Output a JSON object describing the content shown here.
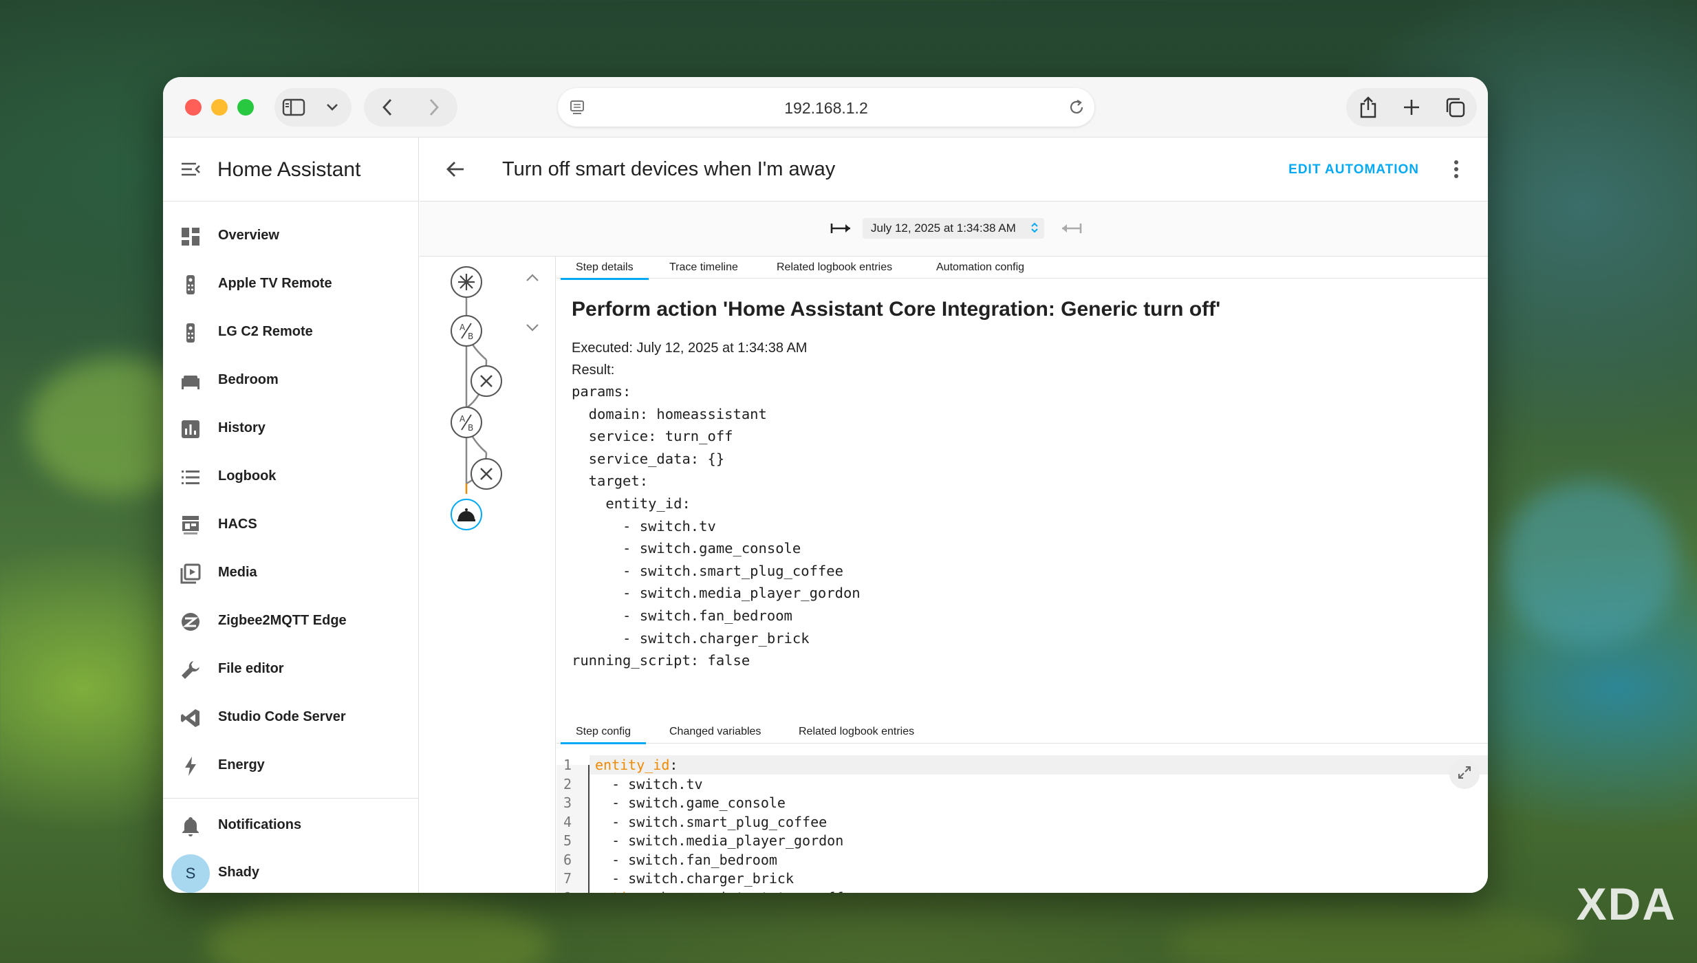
{
  "browser": {
    "url": "192.168.1.2"
  },
  "sidebar": {
    "app_title": "Home Assistant",
    "items": [
      {
        "label": "Overview",
        "icon": "overview-icon"
      },
      {
        "label": "Apple TV Remote",
        "icon": "remote-icon"
      },
      {
        "label": "LG C2 Remote",
        "icon": "remote-icon"
      },
      {
        "label": "Bedroom",
        "icon": "bed-icon"
      },
      {
        "label": "History",
        "icon": "chart-icon"
      },
      {
        "label": "Logbook",
        "icon": "list-icon"
      },
      {
        "label": "HACS",
        "icon": "hacs-icon"
      },
      {
        "label": "Media",
        "icon": "media-icon"
      },
      {
        "label": "Zigbee2MQTT Edge",
        "icon": "zigbee-icon"
      },
      {
        "label": "File editor",
        "icon": "wrench-icon"
      },
      {
        "label": "Studio Code Server",
        "icon": "vscode-icon"
      },
      {
        "label": "Energy",
        "icon": "lightning-icon"
      }
    ],
    "notifications_label": "Notifications",
    "user": {
      "initial": "S",
      "name": "Shady"
    }
  },
  "toolbar": {
    "title": "Turn off smart devices when I'm away",
    "edit_label": "EDIT AUTOMATION"
  },
  "trace": {
    "selected_run": "July 12, 2025 at 1:34:38 AM"
  },
  "tabs_top": [
    "Step details",
    "Trace timeline",
    "Related logbook entries",
    "Automation config"
  ],
  "step": {
    "title": "Perform action 'Home Assistant Core Integration: Generic turn off'",
    "executed": "Executed: July 12, 2025 at 1:34:38 AM",
    "result_label": "Result:",
    "result_yaml": "params:\n  domain: homeassistant\n  service: turn_off\n  service_data: {}\n  target:\n    entity_id:\n      - switch.tv\n      - switch.game_console\n      - switch.smart_plug_coffee\n      - switch.media_player_gordon\n      - switch.fan_bedroom\n      - switch.charger_brick\nrunning_script: false"
  },
  "tabs_bottom": [
    "Step config",
    "Changed variables",
    "Related logbook entries"
  ],
  "code": [
    {
      "n": "1",
      "key": "entity_id",
      "rest": ":"
    },
    {
      "n": "2",
      "key": "",
      "rest": "  - switch.tv"
    },
    {
      "n": "3",
      "key": "",
      "rest": "  - switch.game_console"
    },
    {
      "n": "4",
      "key": "",
      "rest": "  - switch.smart_plug_coffee"
    },
    {
      "n": "5",
      "key": "",
      "rest": "  - switch.media_player_gordon"
    },
    {
      "n": "6",
      "key": "",
      "rest": "  - switch.fan_bedroom"
    },
    {
      "n": "7",
      "key": "",
      "rest": "  - switch.charger_brick"
    },
    {
      "n": "8",
      "key": "action",
      "rest": ": homeassistant.turn_off"
    }
  ],
  "watermark": "XDA",
  "colors": {
    "accent": "#03a9f4",
    "yaml_key": "#ef8a00"
  }
}
